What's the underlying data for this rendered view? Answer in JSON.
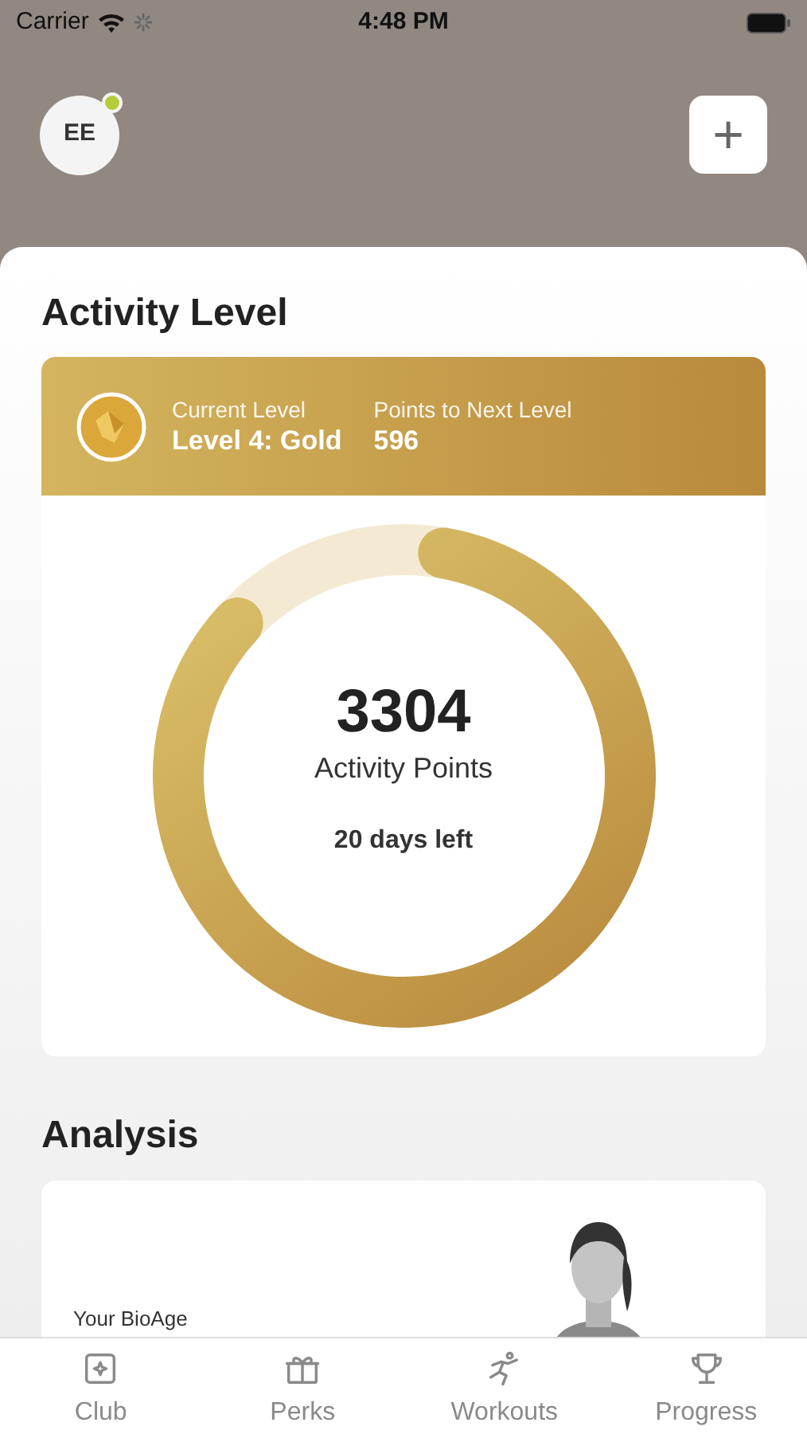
{
  "status_bar": {
    "carrier": "Carrier",
    "time": "4:48 PM"
  },
  "header": {
    "avatar": {
      "initials": "EE",
      "online": true
    },
    "add_button": "+"
  },
  "activity": {
    "title": "Activity Level",
    "current_label": "Current Level",
    "current_value": "Level 4: Gold",
    "next_label": "Points to Next Level",
    "next_value": "596",
    "level": 0.84,
    "points": "3304",
    "points_label": "Activity Points",
    "days_left": "20 days left"
  },
  "analysis": {
    "title": "Analysis",
    "card_label": "Your BioAge"
  },
  "tab_bar": [
    {
      "label": "Club",
      "kind": "club",
      "selected": false
    },
    {
      "label": "Perks",
      "kind": "perks",
      "selected": false
    },
    {
      "label": "Workouts",
      "kind": "workouts",
      "selected": false
    },
    {
      "label": "Progress",
      "kind": "progress",
      "selected": false
    }
  ]
}
